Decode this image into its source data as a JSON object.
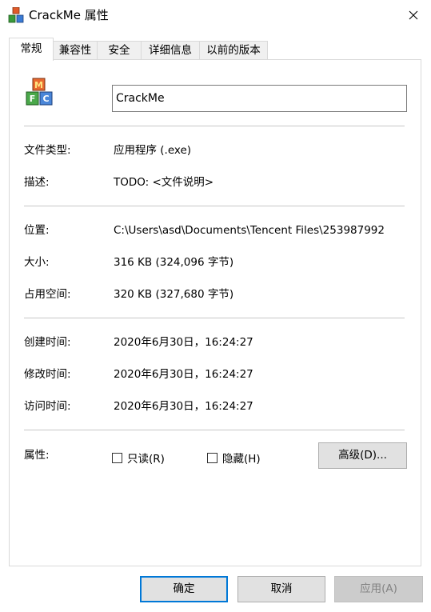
{
  "window": {
    "title": "CrackMe 属性"
  },
  "tabs": [
    {
      "label": "常规"
    },
    {
      "label": "兼容性"
    },
    {
      "label": "安全"
    },
    {
      "label": "详细信息"
    },
    {
      "label": "以前的版本"
    }
  ],
  "general": {
    "file_name": "CrackMe",
    "file_type_label": "文件类型:",
    "file_type_value": "应用程序 (.exe)",
    "description_label": "描述:",
    "description_value": "TODO: <文件说明>",
    "location_label": "位置:",
    "location_value": "C:\\Users\\asd\\Documents\\Tencent Files\\253987992",
    "size_label": "大小:",
    "size_value": "316 KB (324,096 字节)",
    "size_on_disk_label": "占用空间:",
    "size_on_disk_value": "320 KB (327,680 字节)",
    "created_label": "创建时间:",
    "created_value": "2020年6月30日，16:24:27",
    "modified_label": "修改时间:",
    "modified_value": "2020年6月30日，16:24:27",
    "accessed_label": "访问时间:",
    "accessed_value": "2020年6月30日，16:24:27",
    "attributes_label": "属性:",
    "readonly_label": "只读(R)",
    "hidden_label": "隐藏(H)",
    "advanced_label": "高级(D)..."
  },
  "footer": {
    "ok_label": "确定",
    "cancel_label": "取消",
    "apply_label": "应用(A)"
  }
}
